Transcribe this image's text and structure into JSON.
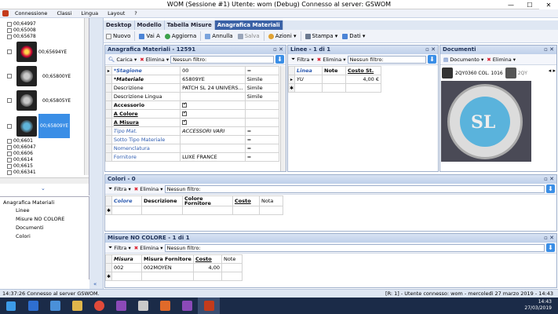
{
  "window": {
    "title": "WOM (Sessione #1) Utente: wom (Debug) Connesso al server: GSWOM",
    "min": "—",
    "max": "☐",
    "close": "✕"
  },
  "menu": [
    "Connessione",
    "Classi",
    "Lingua",
    "Layout",
    "?"
  ],
  "left_list": [
    {
      "label": "00;64997",
      "thumb": false
    },
    {
      "label": "00;65008",
      "thumb": false
    },
    {
      "label": "00;65678",
      "thumb": false
    },
    {
      "label": "00;65694YE",
      "thumb": true
    },
    {
      "label": "00;65800YE",
      "thumb": true
    },
    {
      "label": "00;65805YE",
      "thumb": true
    },
    {
      "label": "00;65809YE",
      "thumb": true,
      "selected": true
    },
    {
      "label": "00;6601",
      "thumb": false
    },
    {
      "label": "00;66047",
      "thumb": false
    },
    {
      "label": "00;6606",
      "thumb": false
    },
    {
      "label": "00;6614",
      "thumb": false
    },
    {
      "label": "00;6615",
      "thumb": false
    },
    {
      "label": "00;66341",
      "thumb": false
    }
  ],
  "nav_tree": {
    "root": "Anagrafica Materiali",
    "children": [
      "Linee",
      "Misure NO COLORE",
      "Documenti",
      "Colori"
    ]
  },
  "tabs": [
    "Desktop",
    "Modello",
    "Tabella Misure",
    "Anagrafica Materiali"
  ],
  "toolbar": {
    "nuovo": "Nuovo",
    "vai": "Vai A",
    "aggiorna": "Aggiorna",
    "annulla": "Annulla",
    "salva": "Salva",
    "azioni": "Azioni",
    "stampa": "Stampa",
    "dati": "Dati"
  },
  "anagrafica": {
    "title": "Anagrafica Materiali - 12591",
    "carica": "Carica",
    "elimina": "Elimina",
    "filter": "Nessun filtro:",
    "rows": [
      {
        "label": "*Stagione",
        "value": "00",
        "op": "=",
        "style": "italic-blue",
        "marker": "▸"
      },
      {
        "label": "*Materiale",
        "value": "65809YE",
        "op": "Simile",
        "style": "italic-b",
        "marker": ""
      },
      {
        "label": "Descrizione",
        "value": "PATCH SL 24 UNIVERS...",
        "op": "Simile",
        "style": "",
        "marker": ""
      },
      {
        "label": "Descrizione Lingua",
        "value": "",
        "op": "Simile",
        "style": "",
        "marker": ""
      },
      {
        "label": "Accessorio",
        "value": "check",
        "op": "",
        "style": "bold",
        "marker": ""
      },
      {
        "label": "A Colore",
        "value": "check",
        "op": "",
        "style": "bold-u",
        "marker": ""
      },
      {
        "label": "A Misura",
        "value": "check",
        "op": "",
        "style": "bold-u",
        "marker": ""
      },
      {
        "label": "Tipo Mat.",
        "value": "ACCESSORI VARI",
        "op": "=",
        "style": "blue-it",
        "marker": ""
      },
      {
        "label": "Sotto Tipo Materiale",
        "value": "",
        "op": "=",
        "style": "blue",
        "marker": ""
      },
      {
        "label": "Nomenclatura",
        "value": "",
        "op": "=",
        "style": "blue",
        "marker": ""
      },
      {
        "label": "Fornitore",
        "value": "LUXE FRANCE",
        "op": "=",
        "style": "blue",
        "marker": ""
      }
    ]
  },
  "linee": {
    "title": "Linee - 1 di 1",
    "filtra": "Filtra",
    "elimina": "Elimina",
    "filter": "Nessun filtro:",
    "headers": [
      "Linea",
      "Note",
      "Costo St."
    ],
    "rows": [
      {
        "linea": "YU",
        "note": "",
        "costo": "4,00 €"
      }
    ]
  },
  "documenti": {
    "title": "Documenti",
    "documento": "Documento",
    "elimina": "Elimina",
    "tab1": "2QY0360 COL. 1016",
    "tab2": "2QY"
  },
  "colori": {
    "title": "Colori - 0",
    "filtra": "Filtra",
    "elimina": "Elimina",
    "filter": "Nessun filtro:",
    "headers": [
      "Colore",
      "Descrizione",
      "Colore Fornitore",
      "Costo",
      "Nota"
    ]
  },
  "misure": {
    "title": "Misure NO COLORE - 1 di 1",
    "filtra": "Filtra",
    "elimina": "Elimina",
    "filter": "Nessun filtro:",
    "headers": [
      "Misura",
      "Misura Fornitore",
      "Costo",
      "Note"
    ],
    "rows": [
      {
        "misura": "002",
        "fornitore": "002MOYEN",
        "costo": "4,00",
        "note": ""
      }
    ]
  },
  "status": {
    "left": "14:37:26  Connesso al server GSWOM.",
    "right": "[R: 1]  -  Utente connesso: wom  -  mercoledì 27 marzo 2019  -  14:43"
  },
  "clock": {
    "time": "14:43",
    "date": "27/03/2019"
  }
}
